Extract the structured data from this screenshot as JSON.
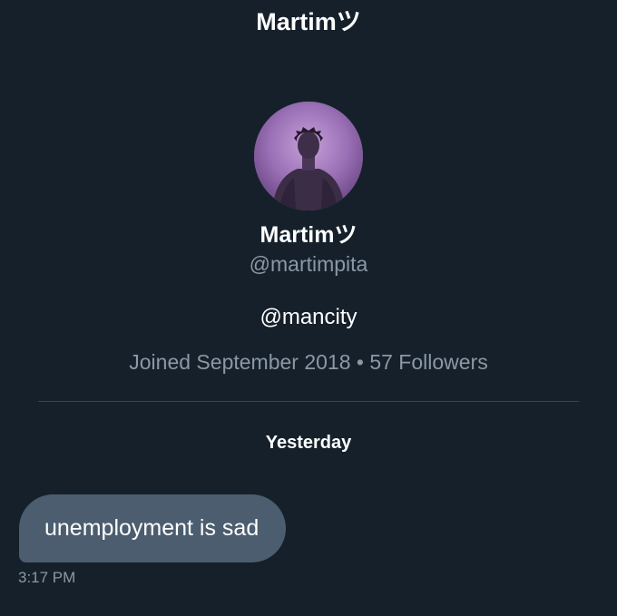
{
  "header": {
    "title": "Martimツ"
  },
  "profile": {
    "avatar_icon": "profile-photo",
    "name": "Martimツ",
    "handle": "@martimpita",
    "bio": "@mancity",
    "meta": "Joined September 2018 • 57 Followers"
  },
  "conversation": {
    "date_separator": "Yesterday",
    "messages": [
      {
        "text": "unemployment is sad",
        "time": "3:17 PM"
      }
    ]
  },
  "colors": {
    "background": "#15202b",
    "bubble": "#4b5d6f",
    "secondary_text": "#8b98a5",
    "divider": "#38444d"
  }
}
